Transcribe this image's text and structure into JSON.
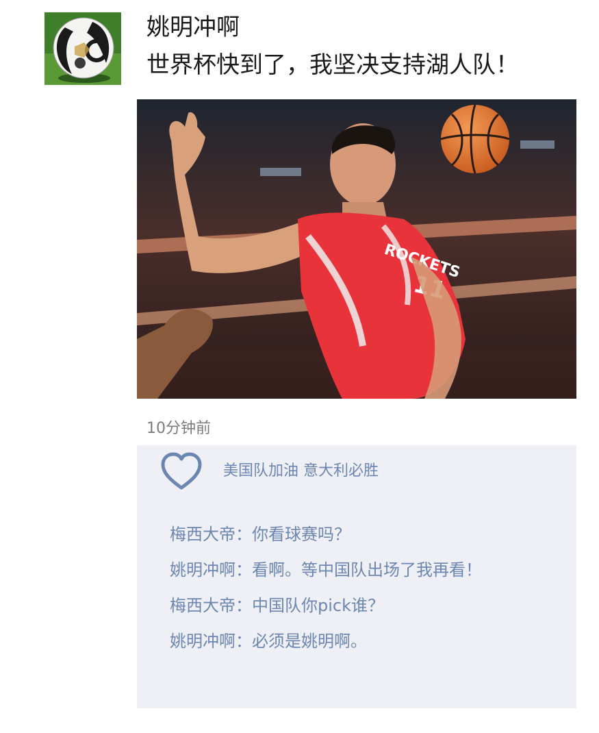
{
  "post": {
    "username": "姚明冲啊",
    "text": "世界杯快到了，我坚决支持湖人队！",
    "timestamp": "10分钟前",
    "avatar_icon": "soccer-ball-icon",
    "photo_icon": "basketball-player-photo",
    "photo_jersey_text": "ROCKETS 11"
  },
  "likes": {
    "icon": "heart-icon",
    "names": "美国队加油 意大利必胜"
  },
  "comments": [
    {
      "author": "梅西大帝",
      "separator": "：",
      "text": "你看球赛吗？"
    },
    {
      "author": "姚明冲啊",
      "separator": "：",
      "text": "看啊。等中国队出场了我再看！"
    },
    {
      "author": "梅西大帝",
      "separator": "：",
      "text": "中国队你pick谁？"
    },
    {
      "author": "姚明冲啊",
      "separator": "：",
      "text": "必须是姚明啊。"
    }
  ],
  "colors": {
    "link_blue": "#6b86b0",
    "comment_bg": "#efeff6",
    "jersey_red": "#e8333a"
  }
}
